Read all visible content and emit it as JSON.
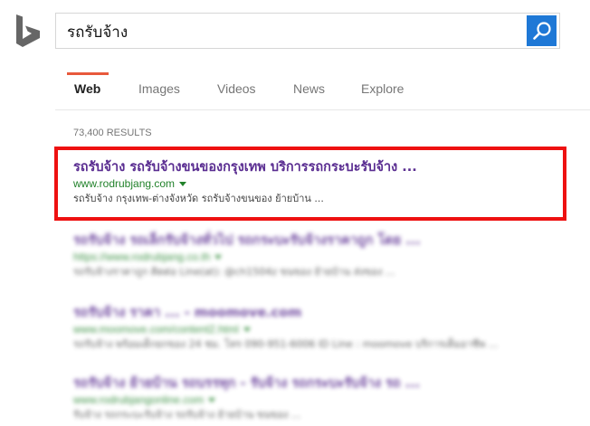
{
  "search": {
    "query": "รถรับจ้าง"
  },
  "tabs": [
    {
      "label": "Web",
      "active": true
    },
    {
      "label": "Images",
      "active": false
    },
    {
      "label": "Videos",
      "active": false
    },
    {
      "label": "News",
      "active": false
    },
    {
      "label": "Explore",
      "active": false
    }
  ],
  "result_count": "73,400 RESULTS",
  "results": [
    {
      "title": "รถรับจ้าง รถรับจ้างขนของกรุงเทพ บริการรถกระบะรับจ้าง ...",
      "url": "www.rodrubjang.com",
      "snippet": "รถรับจ้าง กรุงเทพ-ต่างจังหวัด รถรับจ้างขนของ ย้ายบ้าน ..."
    },
    {
      "title": "รถรับจ้าง รถเล็กรับจ้างทั่วไป รถกระบะรับจ้างราคาถูก โดย ...",
      "url": "https://www.rodrubjang.co.th",
      "snippet": "รถรับจ้างราคาถูก ติดต่อ Line(at): @ch1504z ขนของ ย้ายบ้าน ส่งของ ..."
    },
    {
      "title": "รถรับจ้าง ราคา ... - moomove.com",
      "url": "www.moomove.com/content2.html",
      "snippet": "รถรับจ้าง พร้อมเด็กยกของ 24 ชม. โทร 090-951-6006 ID Line : moomove บริการเต็มอาชีพ ..."
    },
    {
      "title": "รถรับจ้าง ย้ายบ้าน รถบรรทุก - รับจ้าง รถกระบะรับจ้าง รถ ...",
      "url": "www.rodrubjangonline.com",
      "snippet": "รับจ้าง รถกระบะรับจ้าง รถรับจ้าง ย้ายบ้าน ขนของ ..."
    }
  ],
  "colors": {
    "accent_tab": "#e8593c",
    "search_button": "#1e78d6",
    "title_link": "#5a2d91",
    "url_green": "#22822b",
    "highlight_red": "#ee1111"
  },
  "icons": {
    "logo": "bing-logo-icon",
    "search": "search-icon"
  }
}
